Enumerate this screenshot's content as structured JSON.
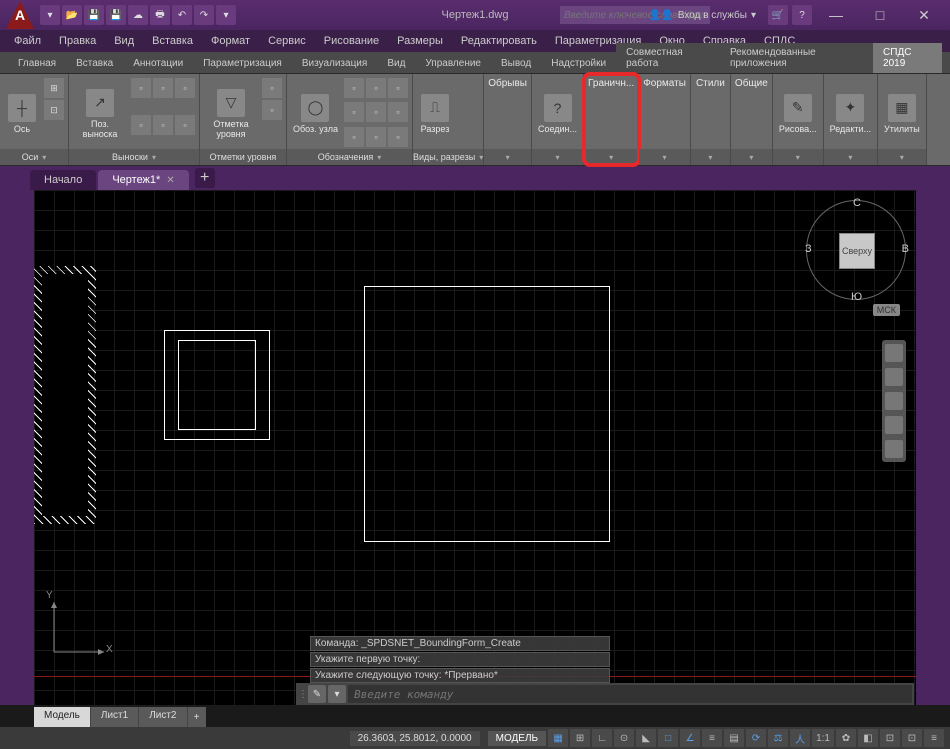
{
  "title": "Чертеж1.dwg",
  "search_placeholder": "Введите ключевое слово/фразу",
  "signin_label": "Вход в службы",
  "menus": [
    "Файл",
    "Правка",
    "Вид",
    "Вставка",
    "Формат",
    "Сервис",
    "Рисование",
    "Размеры",
    "Редактировать",
    "Параметризация",
    "Окно",
    "Справка",
    "СПДС"
  ],
  "ribbon_tabs": [
    "Главная",
    "Вставка",
    "Аннотации",
    "Параметризация",
    "Визуализация",
    "Вид",
    "Управление",
    "Вывод",
    "Надстройки",
    "Совместная работа",
    "Рекомендованные приложения"
  ],
  "ribbon_tab_spds": "СПДС 2019",
  "panels": {
    "axes": {
      "main": "Ось",
      "footer": "Оси"
    },
    "callouts": {
      "main": "Поз. выноска",
      "footer": "Выноски"
    },
    "levels": {
      "main": "Отметка уровня",
      "footer": "Отметки уровня"
    },
    "designations": {
      "main": "Обоз. узла",
      "footer": "Обозначения"
    },
    "sections": {
      "main": "Разрез",
      "footer": "Виды, разрезы"
    },
    "breaks": "Обрывы",
    "connect": "Соедин...",
    "boundary": "Граничн...",
    "formats": "Форматы",
    "styles": "Стили",
    "general": "Общие",
    "draw": "Рисова...",
    "edit": "Редакти...",
    "utilities": "Утилиты"
  },
  "doctabs": {
    "start": "Начало",
    "drawing": "Чертеж1*"
  },
  "viewcube": {
    "top": "Сверху",
    "n": "С",
    "s": "Ю",
    "e": "В",
    "w": "З",
    "wcs": "МСК"
  },
  "cmdlog": [
    "Команда: _SPDSNET_BoundingForm_Create",
    "Укажите первую точку:",
    "Укажите следующую точку: *Прервано*"
  ],
  "cmd_placeholder": "Введите команду",
  "sheets": {
    "model": "Модель",
    "l1": "Лист1",
    "l2": "Лист2"
  },
  "status": {
    "coords": "26.3603, 25.8012, 0.0000",
    "model": "МОДЕЛЬ"
  },
  "ucs": {
    "x": "X",
    "y": "Y"
  }
}
